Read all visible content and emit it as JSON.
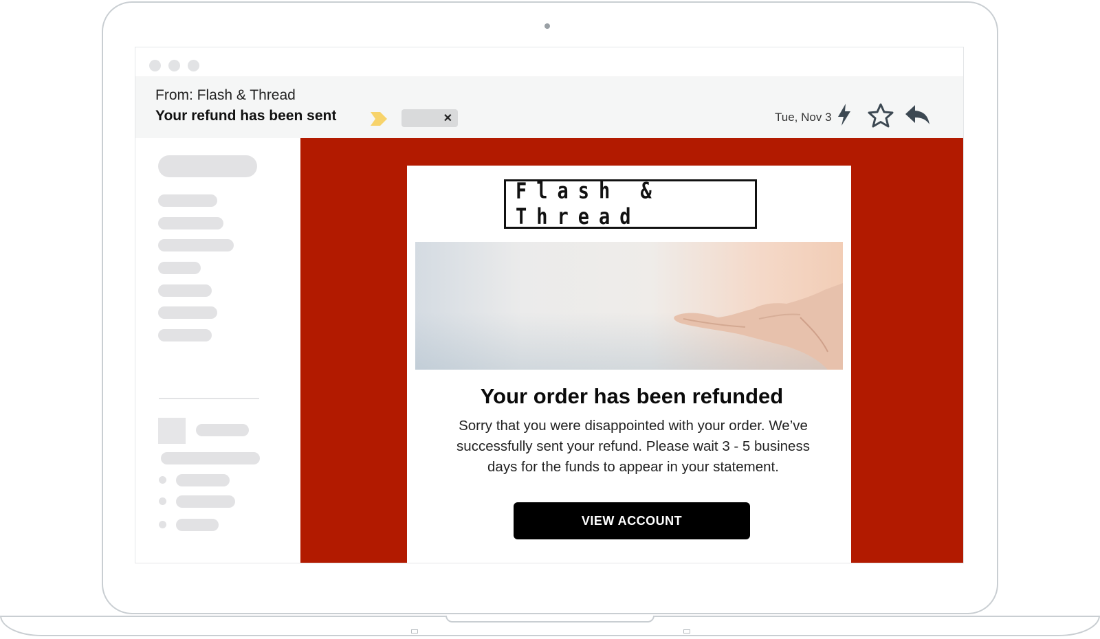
{
  "email": {
    "from": "From: Flash & Thread",
    "subject": "Your refund has been sent",
    "label_close": "✕",
    "date": "Tue, Nov 3"
  },
  "content": {
    "brand_logo": "Flash & Thread",
    "headline": "Your order has been refunded",
    "body": "Sorry that you were disappointed with your order. We’ve successfully sent your refund. Please wait 3 - 5 business days for the funds to appear in your statement.",
    "cta_label": "VIEW ACCOUNT"
  },
  "icons": {
    "label_arrow": "tag-arrow-icon",
    "bolt": "lightning-bolt-icon",
    "star": "star-icon",
    "reply": "reply-icon"
  },
  "colors": {
    "email_background": "#b21a00",
    "button": "#000000",
    "label_arrow": "#f7d36b",
    "header_background": "#f5f6f6"
  }
}
